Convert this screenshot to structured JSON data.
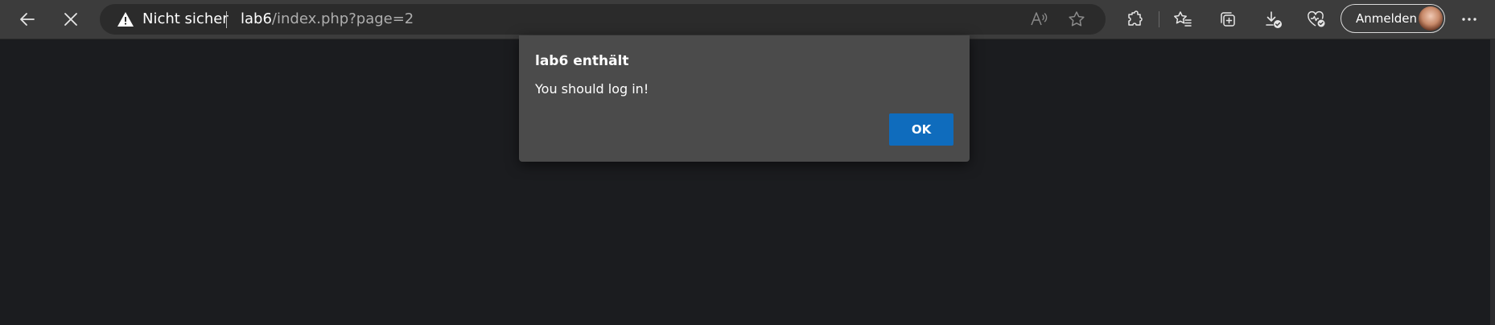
{
  "browser": {
    "nav": {
      "back_icon": "arrow-left-icon",
      "stop_icon": "close-icon"
    },
    "address_bar": {
      "security_icon": "warning-triangle-icon",
      "security_label": "Nicht sicher",
      "url_host": "lab6",
      "url_path": "/index.php?page=2",
      "read_aloud_icon": "read-aloud-icon",
      "favorite_icon": "star-icon"
    },
    "toolbar_icons": [
      "extensions-icon",
      "favorites-icon",
      "collections-icon",
      "downloads-icon",
      "browser-essentials-icon"
    ],
    "signin": {
      "label": "Anmelden",
      "avatar_icon": "profile-avatar"
    },
    "more_icon": "more-options-icon"
  },
  "dialog": {
    "title": "lab6 enthält",
    "message": "You should log in!",
    "ok_label": "OK"
  },
  "colors": {
    "toolbar_bg": "#3c3c3c",
    "page_bg": "#1b1c1f",
    "dialog_bg": "#4b4b4b",
    "accent": "#0f6cbd"
  }
}
